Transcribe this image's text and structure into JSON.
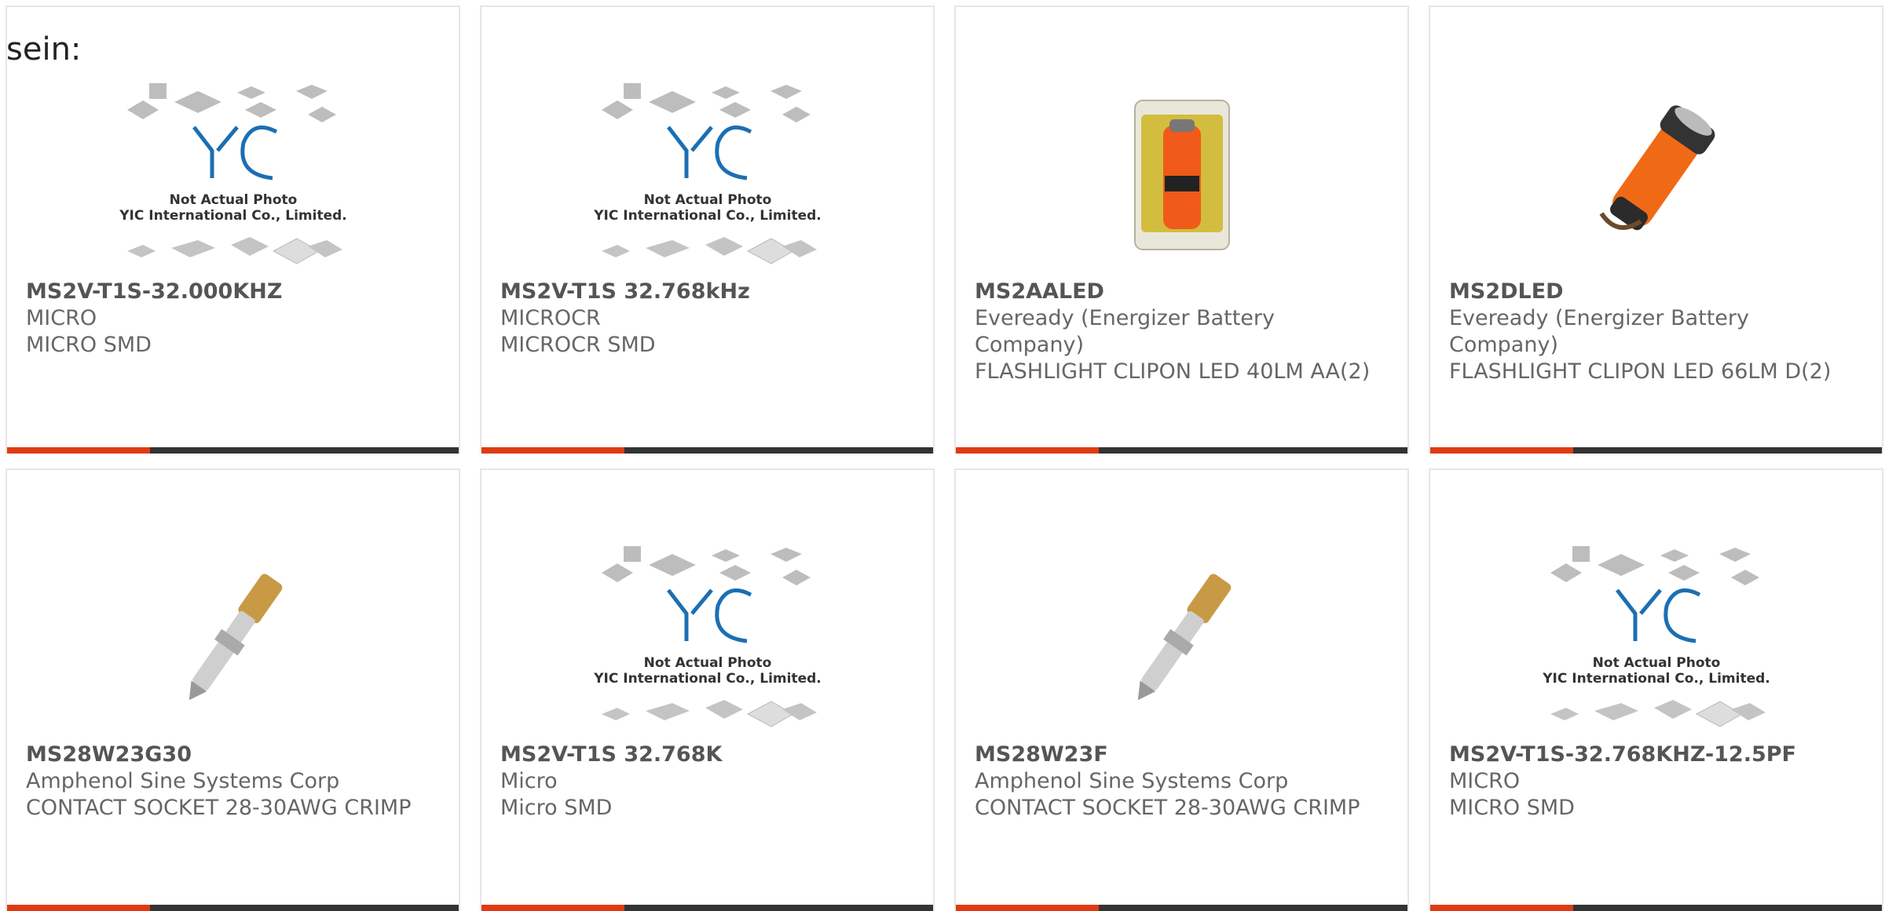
{
  "lead_text": "sein:",
  "placeholder": {
    "logo": "YIC",
    "line1": "Not Actual Photo",
    "line2": "YIC International Co., Limited."
  },
  "colors": {
    "accent": "#e03a12",
    "bar": "#333333",
    "text": "#666666",
    "border": "#e6e6e6"
  },
  "products": [
    {
      "part_number": "MS2V-T1S-32.000KHZ",
      "manufacturer": "MICRO",
      "description": "MICRO SMD",
      "image": "placeholder"
    },
    {
      "part_number": "MS2V-T1S 32.768kHz",
      "manufacturer": "MICROCR",
      "description": "MICROCR SMD",
      "image": "placeholder"
    },
    {
      "part_number": "MS2AALED",
      "manufacturer": "Eveready (Energizer Battery Company)",
      "description": "FLASHLIGHT CLIPON LED 40LM AA(2)",
      "image": "flashlight-pack"
    },
    {
      "part_number": "MS2DLED",
      "manufacturer": "Eveready (Energizer Battery Company)",
      "description": "FLASHLIGHT CLIPON LED 66LM D(2)",
      "image": "flashlight"
    },
    {
      "part_number": "MS28W23G30",
      "manufacturer": "Amphenol Sine Systems Corp",
      "description": "CONTACT SOCKET 28-30AWG CRIMP",
      "image": "contact-socket"
    },
    {
      "part_number": "MS2V-T1S 32.768K",
      "manufacturer": "Micro",
      "description": "Micro SMD",
      "image": "placeholder"
    },
    {
      "part_number": "MS28W23F",
      "manufacturer": "Amphenol Sine Systems Corp",
      "description": "CONTACT SOCKET 28-30AWG CRIMP",
      "image": "contact-socket"
    },
    {
      "part_number": "MS2V-T1S-32.768KHZ-12.5PF",
      "manufacturer": "MICRO",
      "description": "MICRO SMD",
      "image": "placeholder"
    }
  ]
}
